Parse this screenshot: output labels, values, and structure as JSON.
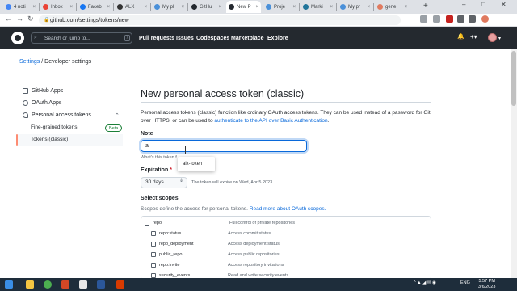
{
  "browser": {
    "tabs": [
      {
        "label": "4 noti",
        "favicon_color": "#4285f4"
      },
      {
        "label": "Inbox",
        "favicon_color": "#ea4335"
      },
      {
        "label": "Faceb",
        "favicon_color": "#1877f2"
      },
      {
        "label": "ALX",
        "favicon_color": "#333333"
      },
      {
        "label": "My pl",
        "favicon_color": "#4a90d9"
      },
      {
        "label": "GitHu",
        "favicon_color": "#24292f"
      },
      {
        "label": "New P",
        "favicon_color": "#24292f"
      },
      {
        "label": "Proje",
        "favicon_color": "#4a90d9"
      },
      {
        "label": "Marki",
        "favicon_color": "#21759b"
      },
      {
        "label": "My pr",
        "favicon_color": "#4a90d9"
      },
      {
        "label": "gene",
        "favicon_color": "#e07a5f"
      }
    ],
    "new_tab_label": "+",
    "url": "github.com/settings/tokens/new",
    "window_controls": {
      "minimize": "–",
      "maximize": "□",
      "close": "✕"
    },
    "nav": {
      "back": "←",
      "forward": "→",
      "reload": "↻"
    }
  },
  "github_header": {
    "search_placeholder": "Search or jump to...",
    "search_key": "/",
    "nav_items": [
      "Pull requests",
      "Issues",
      "Codespaces",
      "Marketplace",
      "Explore"
    ],
    "icons": {
      "bell": "🔔",
      "plus": "+▾",
      "avatar_caret": "▾"
    }
  },
  "breadcrumb": {
    "settings": "Settings",
    "separator": " / ",
    "developer": "Developer settings"
  },
  "sidebar": {
    "items": [
      {
        "label": "GitHub Apps"
      },
      {
        "label": "OAuth Apps"
      },
      {
        "label": "Personal access tokens"
      }
    ],
    "subitems": [
      {
        "label": "Fine-grained tokens",
        "badge": "Beta"
      },
      {
        "label": "Tokens (classic)"
      }
    ],
    "caret": "⌃"
  },
  "main": {
    "title": "New personal access token (classic)",
    "intro_text": "Personal access tokens (classic) function like ordinary OAuth access tokens. They can be used instead of a password for Git over HTTPS, or can be used to ",
    "intro_link": "authenticate to the API over Basic Authentication",
    "intro_end": ".",
    "note_label": "Note",
    "note_value": "a",
    "note_hint": "What's this token f",
    "autocomplete_option": "alx-token",
    "expiration_label": "Expiration",
    "expiration_required": "*",
    "expiration_value": "30 days",
    "expiration_caret": "⇕",
    "expiration_note": "The token will expire on Wed, Apr 5 2023",
    "scopes_label": "Select scopes",
    "scopes_desc": "Scopes define the access for personal tokens. ",
    "scopes_link": "Read more about OAuth scopes.",
    "scopes": [
      {
        "name": "repo",
        "desc": "Full control of private repositories",
        "sub": false
      },
      {
        "name": "repo:status",
        "desc": "Access commit status",
        "sub": true
      },
      {
        "name": "repo_deployment",
        "desc": "Access deployment status",
        "sub": true
      },
      {
        "name": "public_repo",
        "desc": "Access public repositories",
        "sub": true
      },
      {
        "name": "repo:invite",
        "desc": "Access repository invitations",
        "sub": true
      },
      {
        "name": "security_events",
        "desc": "Read and write security events",
        "sub": true
      }
    ]
  },
  "taskbar": {
    "tray_lang": "ENG",
    "time": "5:57 PM",
    "date": "3/6/2023",
    "tray_icons": "^ ▲ ◢ ✉ ◉"
  },
  "colors": {
    "accent": "#0969da",
    "header_bg": "#24292f",
    "active_bar": "#fd8c73",
    "taskbar": "#1e2d3b"
  }
}
